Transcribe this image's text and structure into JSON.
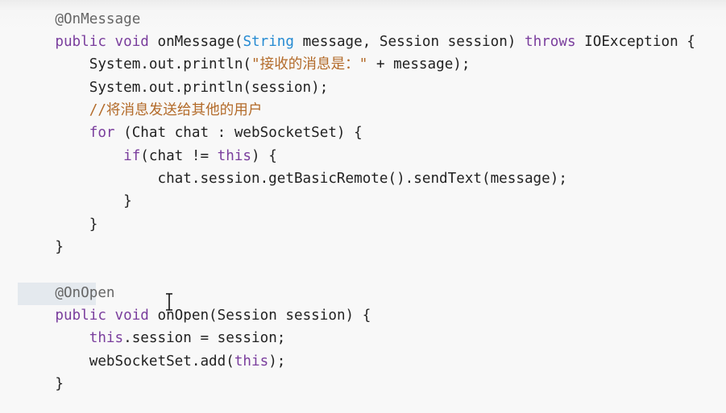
{
  "code": {
    "lines": [
      {
        "indent": "    ",
        "tokens": [
          {
            "t": "@OnMessage",
            "c": "an"
          }
        ]
      },
      {
        "indent": "    ",
        "tokens": [
          {
            "t": "public",
            "c": "kw"
          },
          {
            "t": " ",
            "c": "pl"
          },
          {
            "t": "void",
            "c": "kw"
          },
          {
            "t": " onMessage(",
            "c": "fn"
          },
          {
            "t": "String",
            "c": "ty"
          },
          {
            "t": " message, Session session) ",
            "c": "pl"
          },
          {
            "t": "throws",
            "c": "kw"
          },
          {
            "t": " IOException {",
            "c": "pl"
          }
        ]
      },
      {
        "indent": "        ",
        "tokens": [
          {
            "t": "System.out.println(",
            "c": "pl"
          },
          {
            "t": "\"接收的消息是：\"",
            "c": "st"
          },
          {
            "t": " + message);",
            "c": "pl"
          }
        ]
      },
      {
        "indent": "        ",
        "tokens": [
          {
            "t": "System.out.println(session);",
            "c": "pl"
          }
        ]
      },
      {
        "indent": "        ",
        "tokens": [
          {
            "t": "//将消息发送给其他的用户",
            "c": "cm"
          }
        ]
      },
      {
        "indent": "        ",
        "tokens": [
          {
            "t": "for",
            "c": "kw"
          },
          {
            "t": " (Chat chat : webSocketSet) {",
            "c": "pl"
          }
        ]
      },
      {
        "indent": "            ",
        "tokens": [
          {
            "t": "if",
            "c": "kw"
          },
          {
            "t": "(chat != ",
            "c": "pl"
          },
          {
            "t": "this",
            "c": "kw"
          },
          {
            "t": ") {",
            "c": "pl"
          }
        ]
      },
      {
        "indent": "                ",
        "tokens": [
          {
            "t": "chat.session.getBasicRemote().sendText(message);",
            "c": "pl"
          }
        ]
      },
      {
        "indent": "            ",
        "tokens": [
          {
            "t": "}",
            "c": "pl"
          }
        ]
      },
      {
        "indent": "        ",
        "tokens": [
          {
            "t": "}",
            "c": "pl"
          }
        ]
      },
      {
        "indent": "    ",
        "tokens": [
          {
            "t": "}",
            "c": "pl"
          }
        ]
      },
      {
        "indent": "",
        "tokens": []
      },
      {
        "indent": "    ",
        "tokens": [
          {
            "t": "@OnOpen",
            "c": "an"
          }
        ]
      },
      {
        "indent": "    ",
        "tokens": [
          {
            "t": "public",
            "c": "kw"
          },
          {
            "t": " ",
            "c": "pl"
          },
          {
            "t": "void",
            "c": "kw"
          },
          {
            "t": " onOpen(Session session) {",
            "c": "pl"
          }
        ]
      },
      {
        "indent": "        ",
        "tokens": [
          {
            "t": "this",
            "c": "kw"
          },
          {
            "t": ".session = session;",
            "c": "pl"
          }
        ]
      },
      {
        "indent": "        ",
        "tokens": [
          {
            "t": "webSocketSet.add(",
            "c": "pl"
          },
          {
            "t": "this",
            "c": "kw"
          },
          {
            "t": ");",
            "c": "pl"
          }
        ]
      },
      {
        "indent": "    ",
        "tokens": [
          {
            "t": "}",
            "c": "pl"
          }
        ]
      }
    ]
  },
  "colors": {
    "keyword": "#7a3e9d",
    "type": "#268bd2",
    "string": "#b36b2a",
    "comment": "#b36b2a",
    "annotation": "#666666",
    "highlight_line": "#e4e9ee",
    "background": "#f8f8f8"
  },
  "cursor": {
    "icon": "text-cursor-icon"
  }
}
